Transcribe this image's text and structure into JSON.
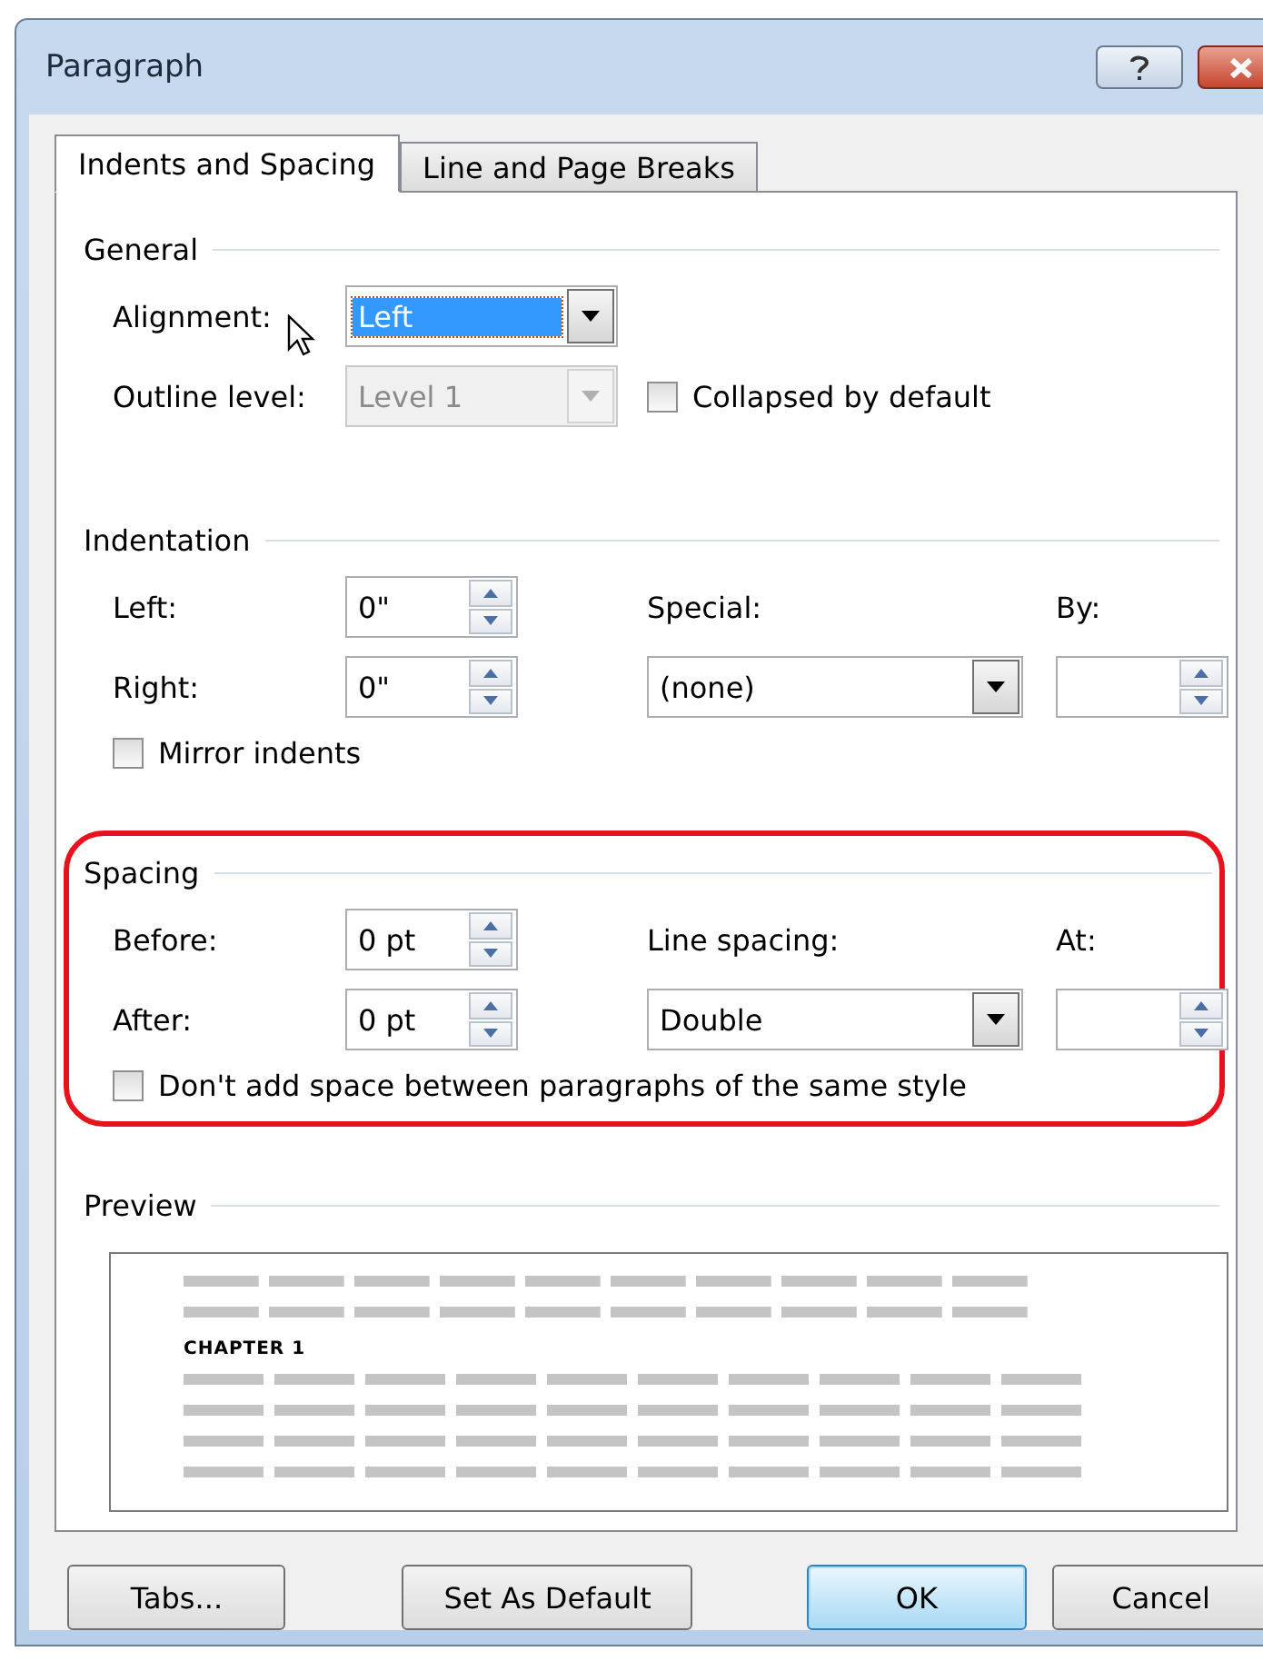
{
  "window": {
    "title": "Paragraph"
  },
  "tabs": [
    {
      "label": "Indents and Spacing",
      "selected": true
    },
    {
      "label": "Line and Page Breaks",
      "selected": false
    }
  ],
  "general": {
    "title": "General",
    "alignment": {
      "label": "Alignment:",
      "value": "Left",
      "focused": true
    },
    "outline_level": {
      "label": "Outline level:",
      "value": "Level 1",
      "disabled": true
    },
    "collapsed": {
      "label": "Collapsed by default",
      "checked": false
    }
  },
  "indentation": {
    "title": "Indentation",
    "left": {
      "label": "Left:",
      "value": "0\""
    },
    "right": {
      "label": "Right:",
      "value": "0\""
    },
    "special": {
      "label": "Special:",
      "value": "(none)"
    },
    "by": {
      "label": "By:"
    },
    "mirror": {
      "label": "Mirror indents",
      "checked": false
    }
  },
  "spacing": {
    "title": "Spacing",
    "highlighted": true,
    "before": {
      "label": "Before:",
      "value": "0 pt"
    },
    "after": {
      "label": "After:",
      "value": "0 pt"
    },
    "line_spacing": {
      "label": "Line spacing:",
      "value": "Double"
    },
    "at": {
      "label": "At:"
    },
    "dont_add": {
      "label": "Don't add space between paragraphs of the same style",
      "checked": false
    }
  },
  "preview": {
    "title": "Preview",
    "sample": "CHAPTER 1"
  },
  "buttons": [
    {
      "label": "Tabs...",
      "default": false
    },
    {
      "label": "Set As Default",
      "default": false
    },
    {
      "label": "OK",
      "default": true
    },
    {
      "label": "Cancel",
      "default": false
    }
  ]
}
